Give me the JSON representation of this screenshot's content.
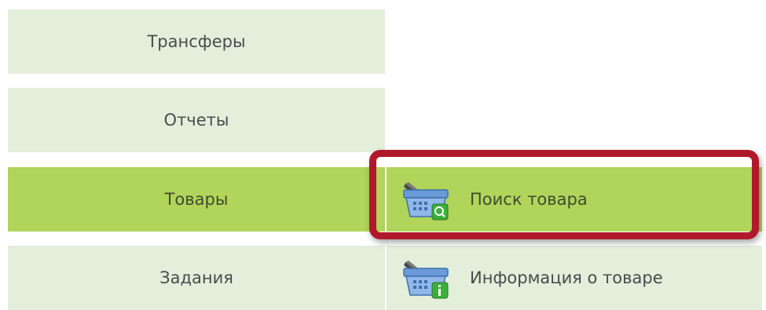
{
  "menu": {
    "items": [
      {
        "label": "Трансферы"
      },
      {
        "label": "Отчеты"
      },
      {
        "label": "Товары"
      },
      {
        "label": "Задания"
      }
    ]
  },
  "submenu": {
    "items": [
      {
        "label": "Поиск товара",
        "icon": "basket-search-icon"
      },
      {
        "label": "Информация о товаре",
        "icon": "basket-info-icon"
      }
    ]
  },
  "colors": {
    "menu_bg": "#e3eedb",
    "active_bg": "#b1d45a",
    "highlight_border": "#b0192c",
    "text": "#4c4c4c"
  }
}
